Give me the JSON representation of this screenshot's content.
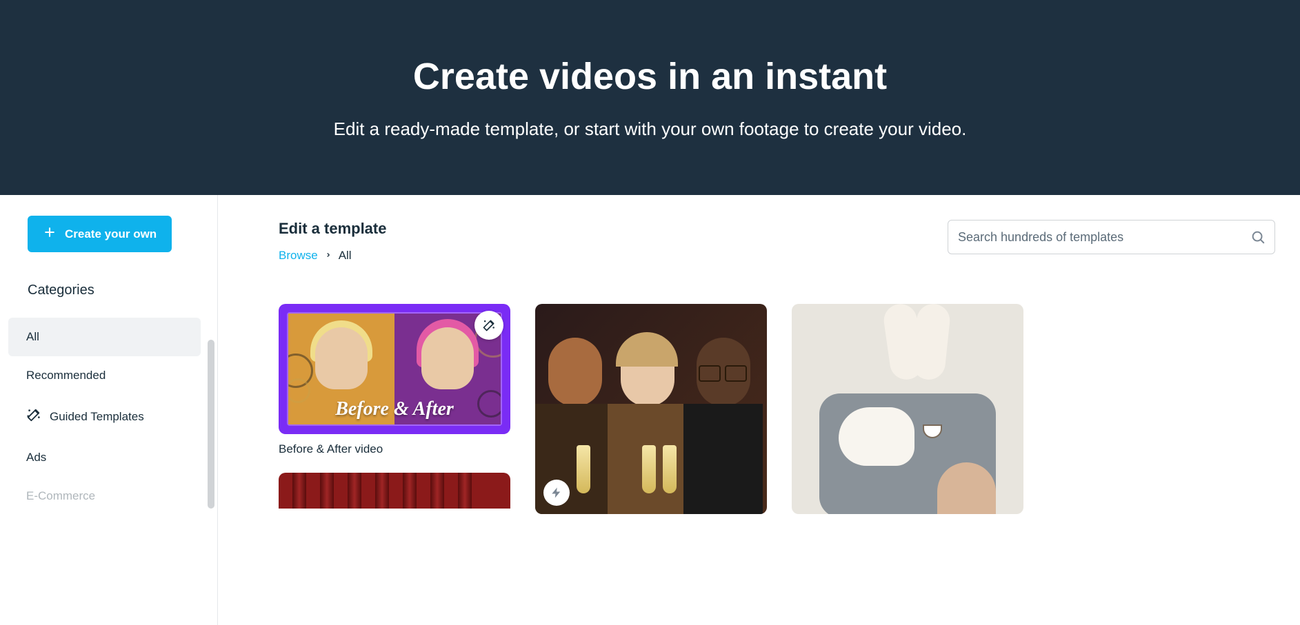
{
  "hero": {
    "title": "Create videos in an instant",
    "subtitle": "Edit a ready-made template, or start with your own footage to create your video."
  },
  "sidebar": {
    "create_button": "Create your own",
    "categories_heading": "Categories",
    "items": [
      {
        "label": "All",
        "active": true
      },
      {
        "label": "Recommended"
      },
      {
        "label": "Guided Templates",
        "icon": "magic-wand"
      },
      {
        "label": "Ads"
      },
      {
        "label": "E-Commerce"
      }
    ]
  },
  "main": {
    "section_title": "Edit a template",
    "breadcrumb": {
      "root": "Browse",
      "current": "All"
    },
    "search_placeholder": "Search hundreds of templates"
  },
  "templates": [
    {
      "title": "Before & After video",
      "overlay_text": "Before & After",
      "badge": "magic-wand"
    }
  ]
}
